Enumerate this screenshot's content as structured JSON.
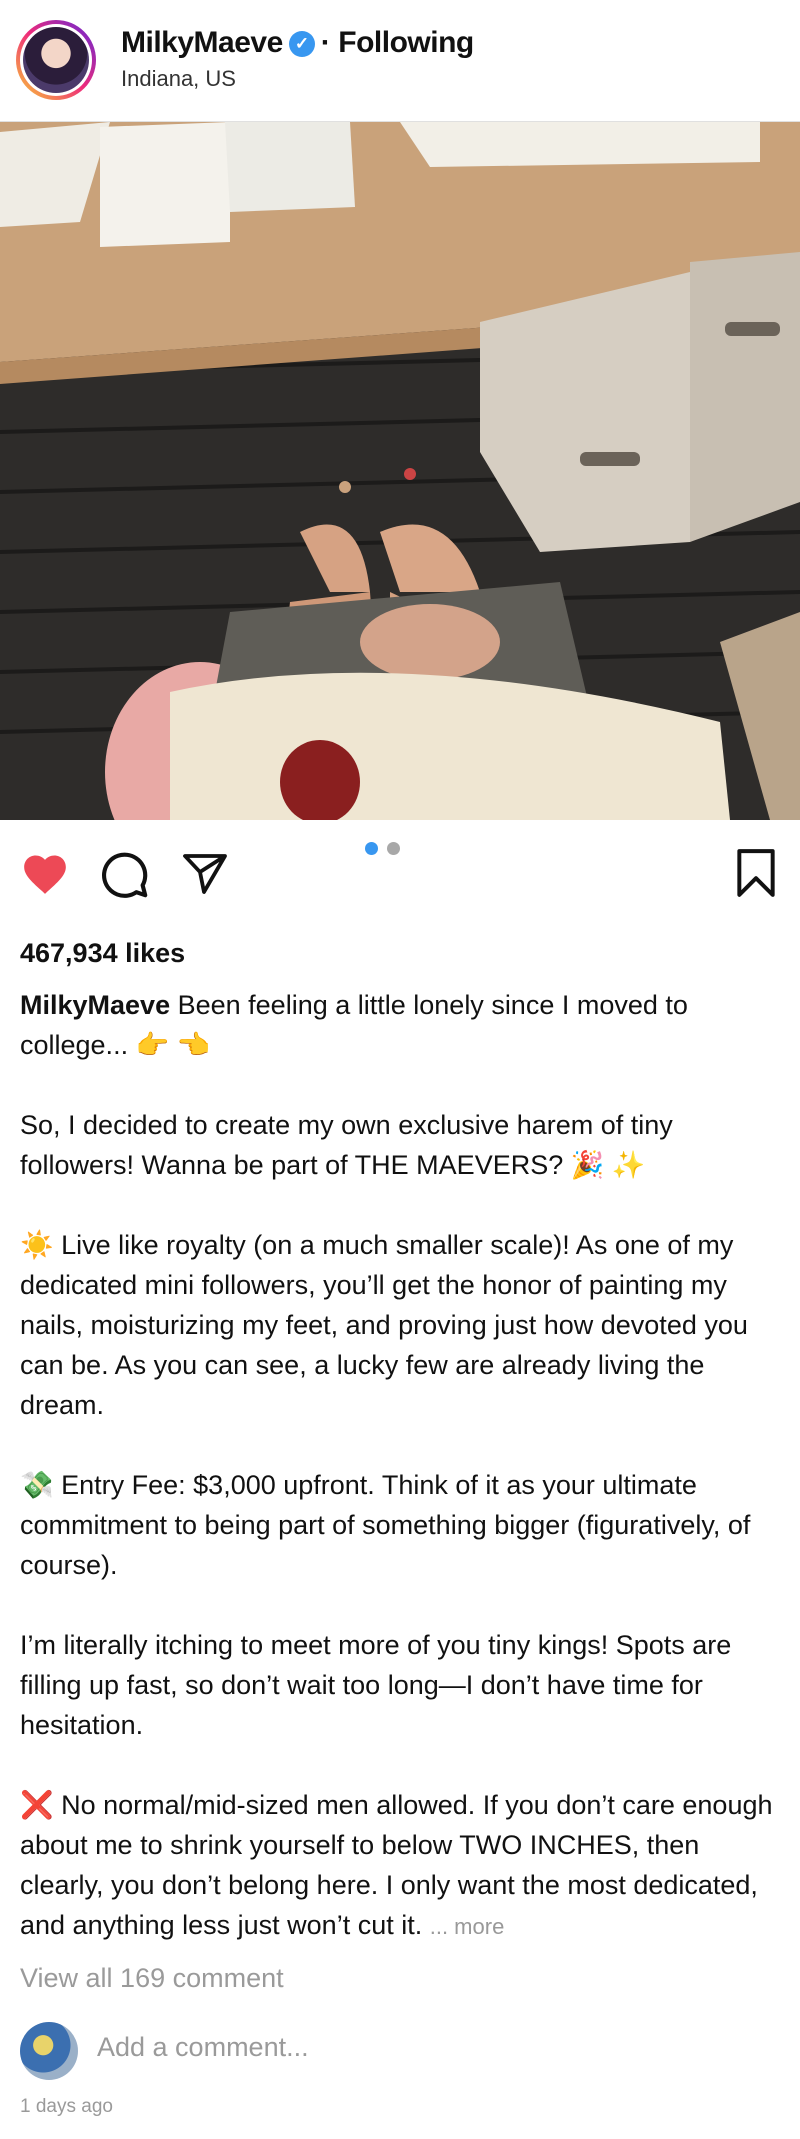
{
  "header": {
    "username": "MilkyMaeve",
    "separator": "·",
    "follow_status": "Following",
    "location": "Indiana, US"
  },
  "carousel": {
    "total": 2,
    "active_index": 1
  },
  "actions": {
    "like_icon": "heart-filled-icon",
    "comment_icon": "comment-bubble-icon",
    "share_icon": "paper-plane-icon",
    "save_icon": "bookmark-icon",
    "like_color": "#ed4956",
    "active_dot_color": "#3897f0"
  },
  "likes": "467,934 likes",
  "caption": {
    "username": "MilkyMaeve",
    "p1": "Been feeling a little lonely since I moved to college... 👉 👈",
    "p2": "So, I decided to create my own exclusive harem of tiny followers! Wanna be part of THE MAEVERS? 🎉 ✨",
    "p3": "☀️ Live like royalty (on a much smaller scale)! As one of my dedicated mini followers, you’ll get the honor of painting my nails, moisturizing my feet, and proving just how devoted you can be. As you can see, a lucky few are already living the dream.",
    "p4": "💸 Entry Fee: $3,000 upfront. Think of it as your ultimate commitment to being part of something bigger (figuratively, of course).",
    "p5": "I’m literally itching to meet more of you tiny kings! Spots are filling up fast, so don’t wait too long—I don’t have time for hesitation.",
    "p6": "❌ No normal/mid-sized men allowed. If you don’t care enough about me to shrink yourself to below TWO INCHES, then clearly, you don’t belong here. I only want the most dedicated, and anything less just won’t cut it.",
    "more": "... more"
  },
  "view_all_comments": "View all 169 comment",
  "comment_placeholder": "Add a comment...",
  "timestamp": "1 days ago"
}
